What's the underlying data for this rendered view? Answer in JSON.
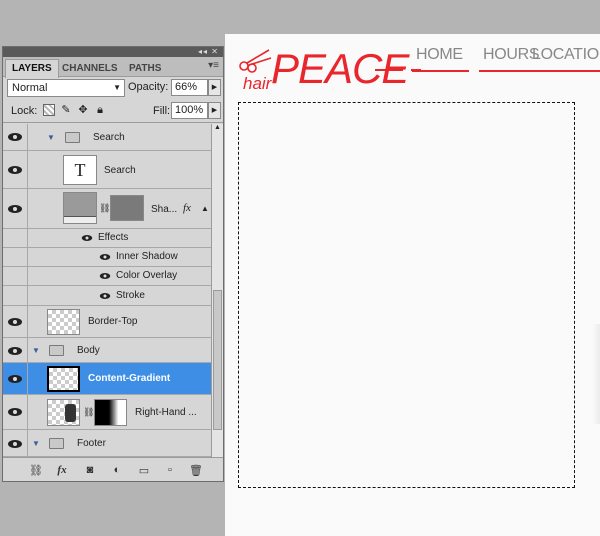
{
  "canvas": {
    "logo_small": "hair",
    "logo_big": "PEACE",
    "nav": [
      {
        "label": "HOME"
      },
      {
        "label": "HOURS"
      },
      {
        "label": "LOCATION"
      }
    ],
    "accent": "#e8262c"
  },
  "panel": {
    "window_controls": "◂◂ ✕",
    "tabs": [
      "LAYERS",
      "CHANNELS",
      "PATHS"
    ],
    "active_tab": "LAYERS",
    "menu_icon": "panel-menu-icon",
    "blend_mode": "Normal",
    "opacity_label": "Opacity:",
    "opacity_value": "66%",
    "lock_label": "Lock:",
    "fill_label": "Fill:",
    "fill_value": "100%",
    "layers": [
      {
        "name": "Search",
        "kind": "group"
      },
      {
        "name": "Search",
        "kind": "text"
      },
      {
        "name": "Sha...",
        "kind": "shape"
      },
      {
        "name": "Effects",
        "kind": "effects-header"
      },
      {
        "name": "Inner Shadow",
        "kind": "effect"
      },
      {
        "name": "Color Overlay",
        "kind": "effect"
      },
      {
        "name": "Stroke",
        "kind": "effect"
      },
      {
        "name": "Border-Top",
        "kind": "layer"
      },
      {
        "name": "Body",
        "kind": "group"
      },
      {
        "name": "Content-Gradient",
        "kind": "layer",
        "selected": true
      },
      {
        "name": "Right-Hand ...",
        "kind": "masked"
      },
      {
        "name": "Footer",
        "kind": "group"
      }
    ],
    "text_layer_glyph": "T",
    "fx_label": "fx",
    "selection_color": "#3d8ee4"
  }
}
